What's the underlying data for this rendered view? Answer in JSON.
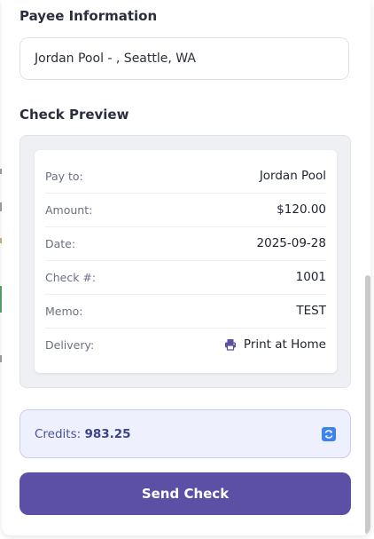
{
  "payee": {
    "heading": "Payee Information",
    "value": "Jordan Pool - , Seattle, WA"
  },
  "preview": {
    "heading": "Check Preview",
    "rows": [
      {
        "label": "Pay to:",
        "value": "Jordan Pool"
      },
      {
        "label": "Amount:",
        "value": "$120.00"
      },
      {
        "label": "Date:",
        "value": "2025-09-28"
      },
      {
        "label": "Check #:",
        "value": "1001"
      },
      {
        "label": "Memo:",
        "value": "TEST"
      },
      {
        "label": "Delivery:",
        "value": "Print at Home",
        "icon": "printer-icon"
      }
    ]
  },
  "credits": {
    "label": "Credits:",
    "amount": "983.25",
    "icon": "refresh-icon"
  },
  "actions": {
    "send_label": "Send Check"
  },
  "colors": {
    "primary_button": "#5b4fa6",
    "credits_bg": "#eef0fd",
    "refresh_icon": "#3b82f6"
  }
}
